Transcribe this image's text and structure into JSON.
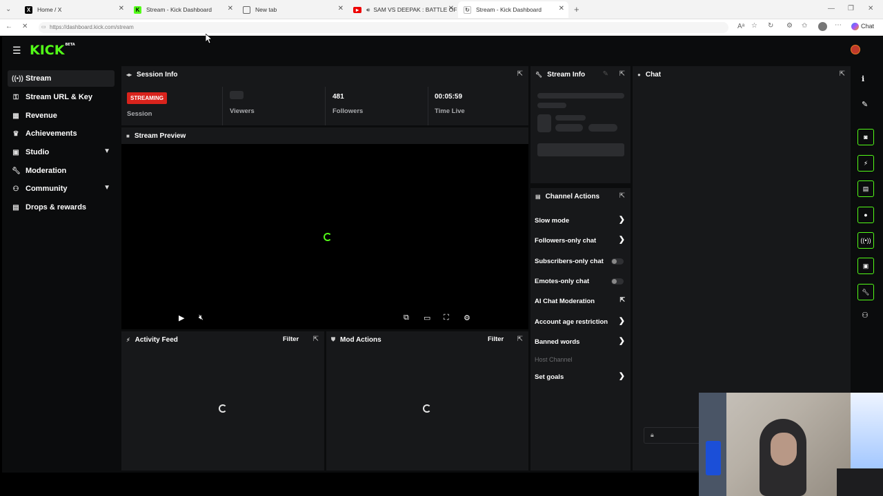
{
  "browser": {
    "tabs": [
      {
        "title": "Home / X",
        "favicon": "x-logo-icon"
      },
      {
        "title": "Stream - Kick Dashboard",
        "favicon": "kick-logo-icon"
      },
      {
        "title": "New tab",
        "favicon": "new-tab-icon"
      },
      {
        "title": "SAM VS DEEPAK : BATTLE OF",
        "favicon": "youtube-icon"
      },
      {
        "title": "Stream - Kick Dashboard",
        "favicon": "kick-logo-icon"
      }
    ],
    "url": "https://dashboard.kick.com/stream",
    "chat_button": "Chat"
  },
  "app": {
    "logo": "KICK",
    "logo_badge": "BETA",
    "accent": "#53fc18"
  },
  "sidebar": {
    "items": [
      {
        "label": "Stream",
        "icon": "stream-icon",
        "active": true
      },
      {
        "label": "Stream URL & Key",
        "icon": "key-icon"
      },
      {
        "label": "Revenue",
        "icon": "revenue-icon"
      },
      {
        "label": "Achievements",
        "icon": "trophy-icon"
      },
      {
        "label": "Studio",
        "icon": "studio-icon",
        "expandable": true
      },
      {
        "label": "Moderation",
        "icon": "wrench-icon"
      },
      {
        "label": "Community",
        "icon": "community-icon",
        "expandable": true
      },
      {
        "label": "Drops & rewards",
        "icon": "gift-icon"
      }
    ]
  },
  "session_info": {
    "title": "Session Info",
    "status_badge": "STREAMING",
    "status_color": "#e1241d",
    "session_label": "Session",
    "viewers_label": "Viewers",
    "followers_value": "481",
    "followers_label": "Followers",
    "time_value": "00:05:59",
    "time_label": "Time Live"
  },
  "stream_preview": {
    "title": "Stream Preview"
  },
  "activity_feed": {
    "title": "Activity Feed",
    "filter": "Filter"
  },
  "mod_actions": {
    "title": "Mod Actions",
    "filter": "Filter"
  },
  "stream_info": {
    "title": "Stream Info"
  },
  "channel_actions": {
    "title": "Channel Actions",
    "items": [
      {
        "label": "Slow mode",
        "control": "arrow"
      },
      {
        "label": "Followers-only chat",
        "control": "arrow"
      },
      {
        "label": "Subscribers-only chat",
        "control": "toggle"
      },
      {
        "label": "Emotes-only chat",
        "control": "toggle"
      },
      {
        "label": "AI Chat Moderation",
        "control": "external"
      },
      {
        "label": "Account age restriction",
        "control": "arrow"
      },
      {
        "label": "Banned words",
        "control": "arrow"
      },
      {
        "label": "Host Channel",
        "control": "disabled"
      },
      {
        "label": "Set goals",
        "control": "arrow"
      }
    ]
  },
  "chat": {
    "title": "Chat"
  }
}
